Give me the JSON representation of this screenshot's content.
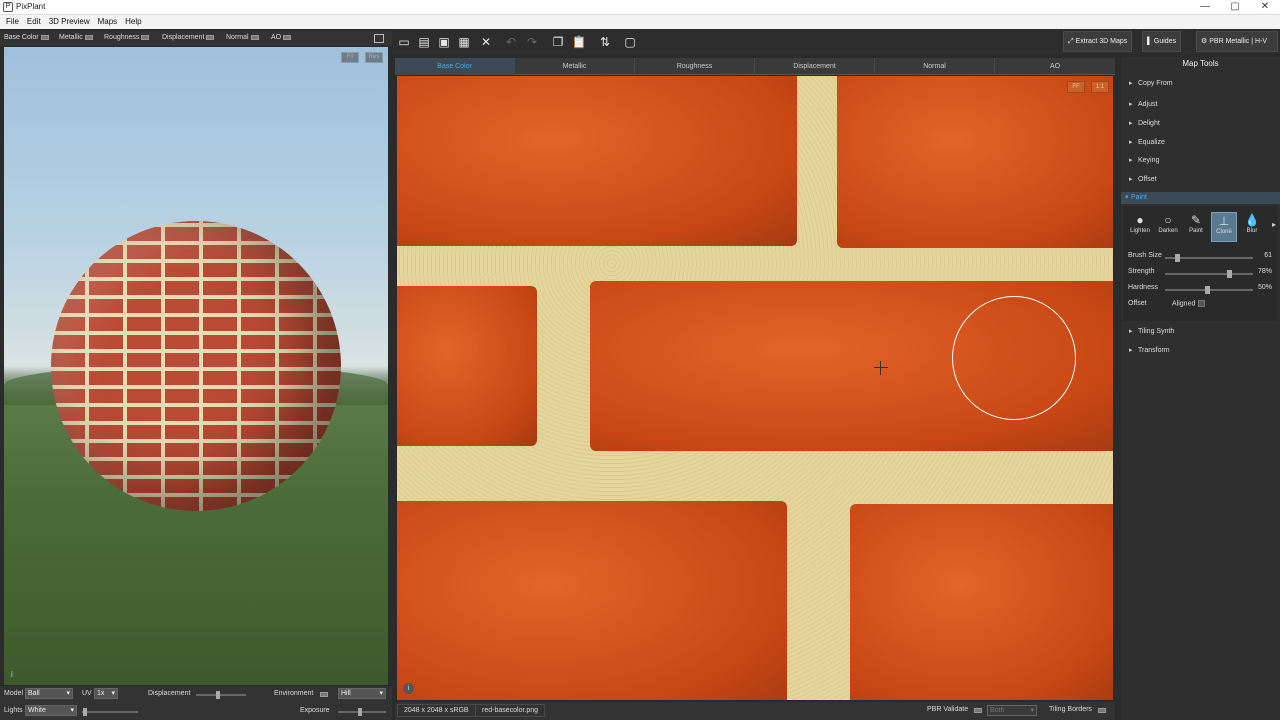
{
  "app": {
    "title": "PixPlant",
    "logo_glyph": "P"
  },
  "window_controls": {
    "minimize": "—",
    "maximize": "▢",
    "close": "✕"
  },
  "menu": [
    "File",
    "Edit",
    "3D Preview",
    "Maps",
    "Help"
  ],
  "left_channels": [
    "Base Color",
    "Metallic",
    "Roughness",
    "Displacement",
    "Normal",
    "AO"
  ],
  "preview": {
    "fit": "Fit",
    "res": "Res",
    "info_glyph": "i"
  },
  "left_bottom": {
    "model_label": "Model",
    "model_value": "Ball",
    "uv_label": "UV",
    "uv_value": "1x",
    "displacement_label": "Displacement",
    "environment_label": "Environment",
    "environment_value": "Hill",
    "lights_label": "Lights",
    "lights_value": "White",
    "exposure_label": "Exposure"
  },
  "toolbar": {
    "icons": [
      "new-icon",
      "open-icon",
      "save-icon",
      "save-as-icon",
      "close-icon",
      "undo-icon",
      "redo-icon",
      "copy-icon",
      "paste-icon",
      "swap-icon",
      "comment-icon"
    ],
    "extract_label": "Extract 3D Maps",
    "guides_label": "Guides",
    "pbr_label": "PBR Metallic | H-V"
  },
  "tabs": [
    "Base Color",
    "Metallic",
    "Roughness",
    "Displacement",
    "Normal",
    "AO"
  ],
  "editor": {
    "ff_label": "FF",
    "one_label": "1:1",
    "info_glyph": "i"
  },
  "status": {
    "dimensions": "2048 x 2048 x sRGB",
    "filename": "red-basecolor.png",
    "pbr_validate": "PBR Validate",
    "both": "Both",
    "tiling_borders": "Tiling Borders"
  },
  "panel": {
    "title": "Map Tools",
    "sections_top": [
      "Copy From",
      "Adjust",
      "Delight",
      "Equalize",
      "Keying",
      "Offset"
    ],
    "paint_title": "Paint",
    "tools": [
      {
        "label": "Lighten",
        "glyph": "●"
      },
      {
        "label": "Darken",
        "glyph": "○"
      },
      {
        "label": "Paint",
        "glyph": "✎"
      },
      {
        "label": "Clone",
        "glyph": "⊥"
      },
      {
        "label": "Blur",
        "glyph": "💧"
      }
    ],
    "brush_size_label": "Brush Size",
    "brush_size_value": "61",
    "strength_label": "Strength",
    "strength_value": "78%",
    "hardness_label": "Hardness",
    "hardness_value": "50%",
    "offset_label": "Offset",
    "aligned_label": "Aligned",
    "sections_bottom": [
      "Tiling Synth",
      "Transform"
    ]
  },
  "colors": {
    "accent": "#4aa8e8",
    "brick": "#d0501c",
    "mortar": "#e6d59a"
  }
}
